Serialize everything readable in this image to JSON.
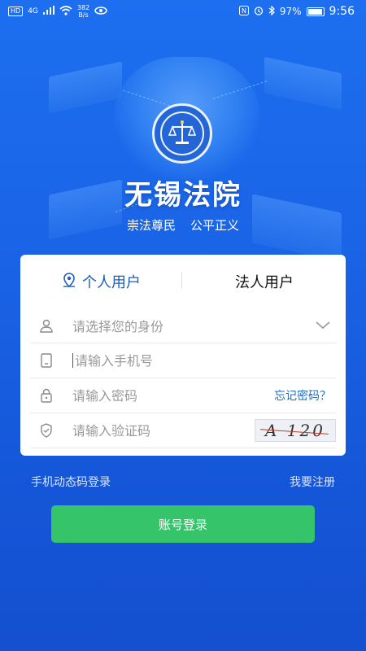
{
  "status_bar": {
    "network": "HD",
    "signal": "4G",
    "speed": "382\nB/s",
    "battery": "97%",
    "time": "9:56"
  },
  "app": {
    "title": "无锡法院",
    "slogan_left": "崇法尊民",
    "slogan_right": "公平正义"
  },
  "tabs": {
    "personal": "个人用户",
    "corporate": "法人用户"
  },
  "form": {
    "identity_placeholder": "请选择您的身份",
    "phone_placeholder": "请输入手机号",
    "password_placeholder": "请输入密码",
    "forgot_label": "忘记密码？",
    "captcha_placeholder": "请输入验证码",
    "captcha_text": "A 120"
  },
  "links": {
    "sms_login": "手机动态码登录",
    "register": "我要注册"
  },
  "login_button": "账号登录",
  "colors": {
    "background": "#1a63e6",
    "accent_blue": "#1e5dbb",
    "login_green": "#35c46a"
  }
}
